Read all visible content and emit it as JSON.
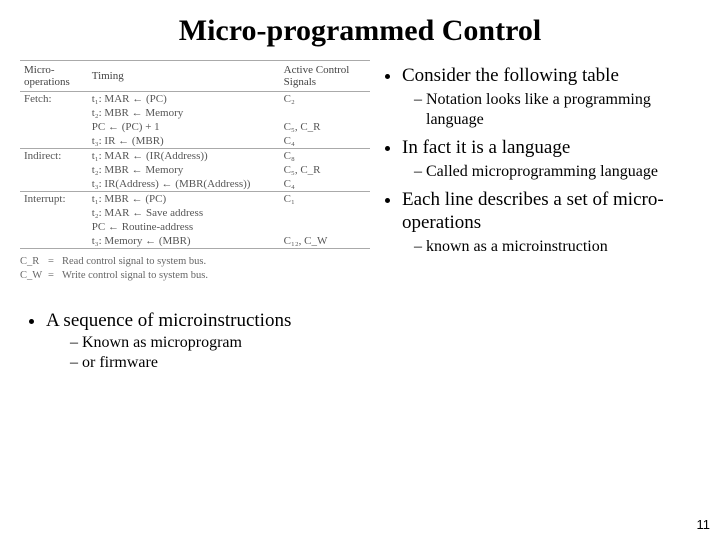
{
  "title": "Micro-programmed Control",
  "table": {
    "headers": [
      "Micro-operations",
      "Timing",
      "Active Control Signals"
    ],
    "phases": [
      {
        "name": "Fetch:",
        "rows": [
          {
            "t": "t₁: MAR ← (PC)",
            "sig": "C₂"
          },
          {
            "t": "t₂: MBR ← Memory",
            "sig": ""
          },
          {
            "t": "    PC ← (PC) + 1",
            "sig": "C₅, C_R"
          },
          {
            "t": "t₃: IR ← (MBR)",
            "sig": "C₄"
          }
        ]
      },
      {
        "name": "Indirect:",
        "rows": [
          {
            "t": "t₁: MAR ← (IR(Address))",
            "sig": "C₈"
          },
          {
            "t": "t₂: MBR ← Memory",
            "sig": "C₅, C_R"
          },
          {
            "t": "t₃: IR(Address) ← (MBR(Address))",
            "sig": "C₄"
          }
        ]
      },
      {
        "name": "Interrupt:",
        "rows": [
          {
            "t": "t₁: MBR ← (PC)",
            "sig": "C₁"
          },
          {
            "t": "t₂: MAR ← Save address",
            "sig": ""
          },
          {
            "t": "    PC ← Routine-address",
            "sig": ""
          },
          {
            "t": "t₃: Memory ← (MBR)",
            "sig": "C₁₂, C_W"
          }
        ]
      }
    ],
    "legend": [
      {
        "sym": "C_R",
        "eq": "=",
        "desc": "Read control signal to system bus."
      },
      {
        "sym": "C_W",
        "eq": "=",
        "desc": "Write control signal to system bus."
      }
    ]
  },
  "bullets_right": [
    {
      "text": "Consider the following table",
      "sub": [
        "Notation looks like a programming language"
      ]
    },
    {
      "text": "In fact it is a language",
      "sub": [
        "Called microprogramming language"
      ]
    },
    {
      "text": "Each line describes a set of micro-operations",
      "sub": [
        "known as a microinstruction"
      ]
    }
  ],
  "bullets_lower": [
    {
      "text": "A sequence of microinstructions",
      "sub": [
        "Known as microprogram",
        "or firmware"
      ]
    }
  ],
  "page_number": "11"
}
